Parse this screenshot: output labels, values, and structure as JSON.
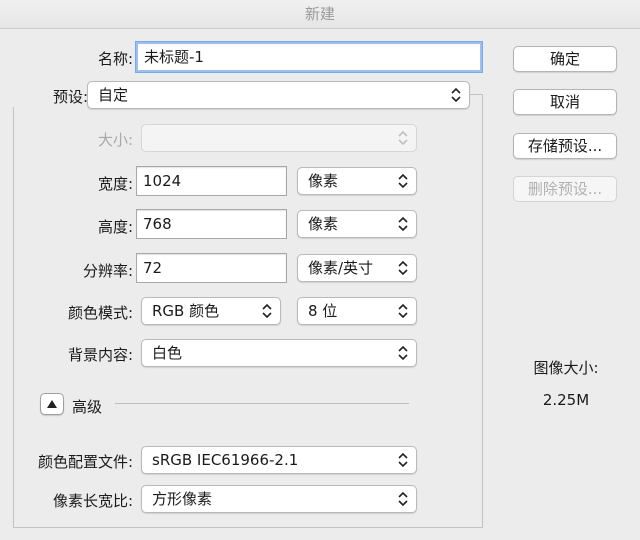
{
  "window": {
    "title": "新建"
  },
  "name": {
    "label": "名称:",
    "value": "未标题-1"
  },
  "preset": {
    "label": "预设:",
    "value": "自定"
  },
  "size": {
    "label": "大小:",
    "value": ""
  },
  "width": {
    "label": "宽度:",
    "value": "1024",
    "unit": "像素"
  },
  "height": {
    "label": "高度:",
    "value": "768",
    "unit": "像素"
  },
  "resolution": {
    "label": "分辨率:",
    "value": "72",
    "unit": "像素/英寸"
  },
  "color_mode": {
    "label": "颜色模式:",
    "value": "RGB 颜色",
    "depth": "8 位"
  },
  "background": {
    "label": "背景内容:",
    "value": "白色"
  },
  "advanced": {
    "label": "高级"
  },
  "color_profile": {
    "label": "颜色配置文件:",
    "value": "sRGB IEC61966-2.1"
  },
  "pixel_aspect": {
    "label": "像素长宽比:",
    "value": "方形像素"
  },
  "buttons": {
    "ok": "确定",
    "cancel": "取消",
    "save_preset": "存储预设...",
    "delete_preset": "删除预设..."
  },
  "image_size": {
    "label": "图像大小:",
    "value": "2.25M"
  },
  "icons": {
    "select": "chevron-updown-icon",
    "advanced": "triangle-up-icon"
  }
}
